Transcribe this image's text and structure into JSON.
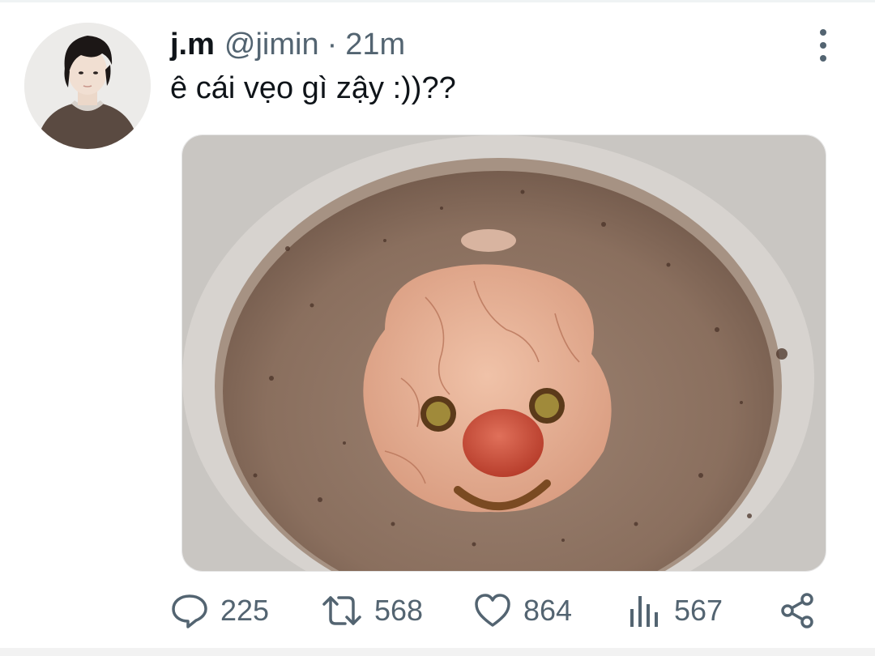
{
  "tweet": {
    "author_name": "j.m",
    "author_handle": "@jimin",
    "separator": "·",
    "time": "21m",
    "text": "ê cái vẹo gì zậy :))??",
    "avatar_icon": "profile-photo",
    "media_description_icon": "photo-cocoa-clown-face"
  },
  "actions": {
    "replies": "225",
    "retweets": "568",
    "likes": "864",
    "views": "567",
    "icons": [
      "reply-icon",
      "retweet-icon",
      "like-icon",
      "views-icon",
      "share-icon"
    ]
  },
  "colors": {
    "secondary_text": "#536471",
    "primary_text": "#0f1419",
    "background": "#ffffff"
  }
}
